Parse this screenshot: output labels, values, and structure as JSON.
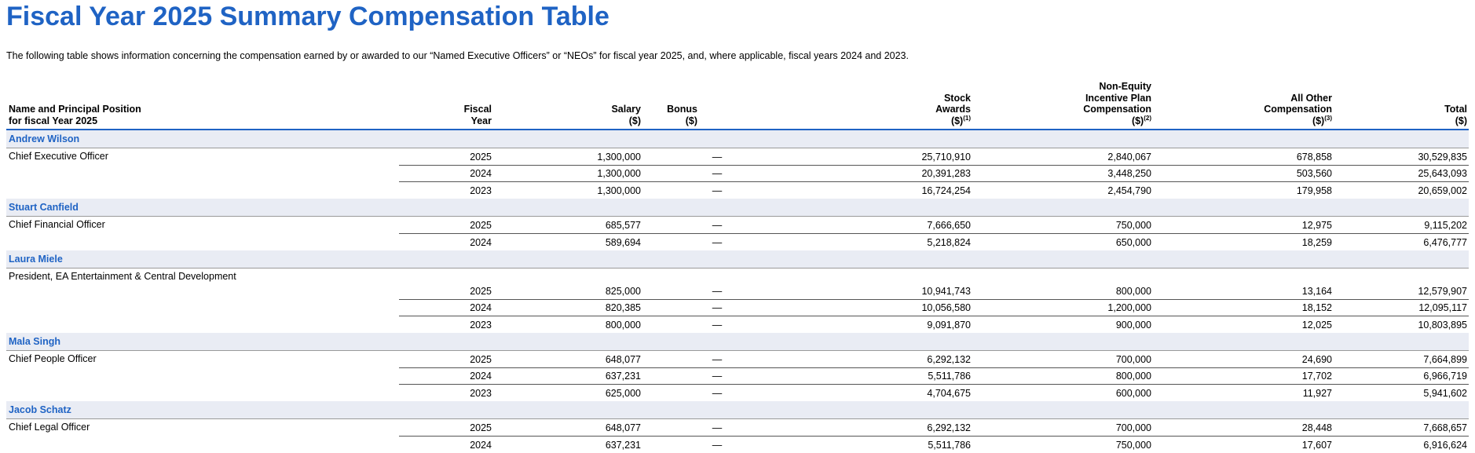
{
  "title": "Fiscal Year 2025 Summary Compensation Table",
  "intro": "The following table shows information concerning the compensation earned by or awarded to our “Named Executive Officers” or “NEOs” for fiscal year 2025, and, where applicable, fiscal years 2024 and 2023.",
  "headers": {
    "position": [
      "Name and Principal Position",
      "for fiscal Year 2025"
    ],
    "year": [
      "Fiscal",
      "Year"
    ],
    "salary": [
      "Salary",
      "($)"
    ],
    "bonus": [
      "Bonus",
      "($)"
    ],
    "stock": [
      "Stock",
      "Awards",
      "($)"
    ],
    "stock_note": "(1)",
    "nonequity": [
      "Non-Equity",
      "Incentive Plan",
      "Compensation",
      "($)"
    ],
    "nonequity_note": "(2)",
    "other": [
      "All Other",
      "Compensation",
      "($)"
    ],
    "other_note": "(3)",
    "total": [
      "Total",
      "($)"
    ]
  },
  "executives": [
    {
      "name": "Andrew Wilson",
      "position": "Chief Executive Officer",
      "rows": [
        {
          "year": "2025",
          "salary": "1,300,000",
          "bonus": "—",
          "stock": "25,710,910",
          "nonequity": "2,840,067",
          "other": "678,858",
          "total": "30,529,835"
        },
        {
          "year": "2024",
          "salary": "1,300,000",
          "bonus": "—",
          "stock": "20,391,283",
          "nonequity": "3,448,250",
          "other": "503,560",
          "total": "25,643,093"
        },
        {
          "year": "2023",
          "salary": "1,300,000",
          "bonus": "—",
          "stock": "16,724,254",
          "nonequity": "2,454,790",
          "other": "179,958",
          "total": "20,659,002"
        }
      ]
    },
    {
      "name": "Stuart Canfield",
      "position": "Chief Financial Officer",
      "rows": [
        {
          "year": "2025",
          "salary": "685,577",
          "bonus": "—",
          "stock": "7,666,650",
          "nonequity": "750,000",
          "other": "12,975",
          "total": "9,115,202"
        },
        {
          "year": "2024",
          "salary": "589,694",
          "bonus": "—",
          "stock": "5,218,824",
          "nonequity": "650,000",
          "other": "18,259",
          "total": "6,476,777"
        }
      ]
    },
    {
      "name": "Laura Miele",
      "position": "President, EA Entertainment & Central Development",
      "rows": [
        {
          "year": "2025",
          "salary": "825,000",
          "bonus": "—",
          "stock": "10,941,743",
          "nonequity": "800,000",
          "other": "13,164",
          "total": "12,579,907"
        },
        {
          "year": "2024",
          "salary": "820,385",
          "bonus": "—",
          "stock": "10,056,580",
          "nonequity": "1,200,000",
          "other": "18,152",
          "total": "12,095,117"
        },
        {
          "year": "2023",
          "salary": "800,000",
          "bonus": "—",
          "stock": "9,091,870",
          "nonequity": "900,000",
          "other": "12,025",
          "total": "10,803,895"
        }
      ]
    },
    {
      "name": "Mala Singh",
      "position": "Chief People Officer",
      "rows": [
        {
          "year": "2025",
          "salary": "648,077",
          "bonus": "—",
          "stock": "6,292,132",
          "nonequity": "700,000",
          "other": "24,690",
          "total": "7,664,899"
        },
        {
          "year": "2024",
          "salary": "637,231",
          "bonus": "—",
          "stock": "5,511,786",
          "nonequity": "800,000",
          "other": "17,702",
          "total": "6,966,719"
        },
        {
          "year": "2023",
          "salary": "625,000",
          "bonus": "—",
          "stock": "4,704,675",
          "nonequity": "600,000",
          "other": "11,927",
          "total": "5,941,602"
        }
      ]
    },
    {
      "name": "Jacob Schatz",
      "position": "Chief Legal Officer",
      "rows": [
        {
          "year": "2025",
          "salary": "648,077",
          "bonus": "—",
          "stock": "6,292,132",
          "nonequity": "700,000",
          "other": "28,448",
          "total": "7,668,657"
        },
        {
          "year": "2024",
          "salary": "637,231",
          "bonus": "—",
          "stock": "5,511,786",
          "nonequity": "750,000",
          "other": "17,607",
          "total": "6,916,624"
        }
      ]
    }
  ],
  "colors": {
    "accent": "#1f63c4",
    "name_row_bg": "#e9ecf4"
  }
}
